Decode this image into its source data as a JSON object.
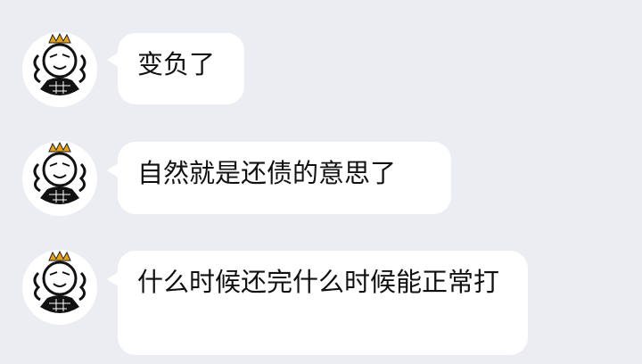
{
  "chat": {
    "messages": [
      {
        "avatar_icon": "crowned-character-avatar-icon",
        "text": "变负了"
      },
      {
        "avatar_icon": "crowned-character-avatar-icon",
        "text": "自然就是还债的意思了"
      },
      {
        "avatar_icon": "crowned-character-avatar-icon",
        "text": "什么时候还完什么时候能正常打"
      }
    ]
  },
  "colors": {
    "background": "#ebedf3",
    "bubble": "#ffffff",
    "text": "#111111",
    "crown": "#e6a21a"
  }
}
